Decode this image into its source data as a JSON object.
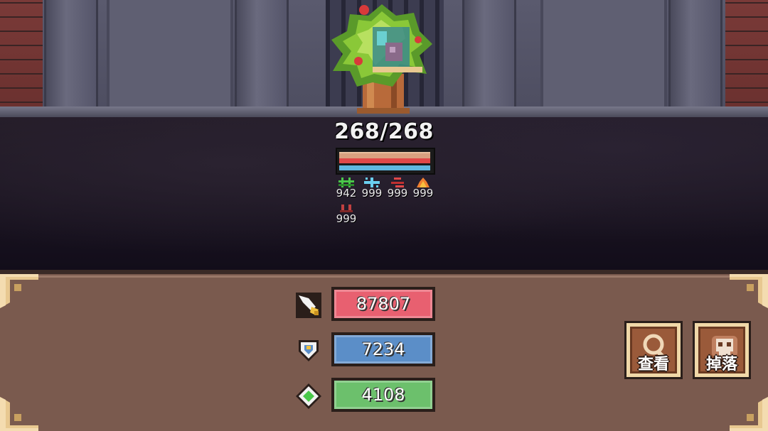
{
  "boss": {
    "hp_text": "268/268",
    "resistances_row1": [
      "942",
      "999",
      "999",
      "999"
    ],
    "resistances_row2": [
      "999"
    ],
    "resistance_icons": [
      "poison-icon",
      "ice-icon",
      "bleed-icon",
      "fire-icon",
      "curse-icon"
    ]
  },
  "stats": {
    "attack": "87807",
    "defense": "7234",
    "speed": "4108"
  },
  "actions": {
    "view_label": "查看",
    "drop_label": "掉落"
  },
  "colors": {
    "attack": "#e86070",
    "defense": "#5b8ec8",
    "speed": "#6cc06c",
    "hp_bar": "#e04848",
    "shield_bar": "#60b8e0"
  }
}
